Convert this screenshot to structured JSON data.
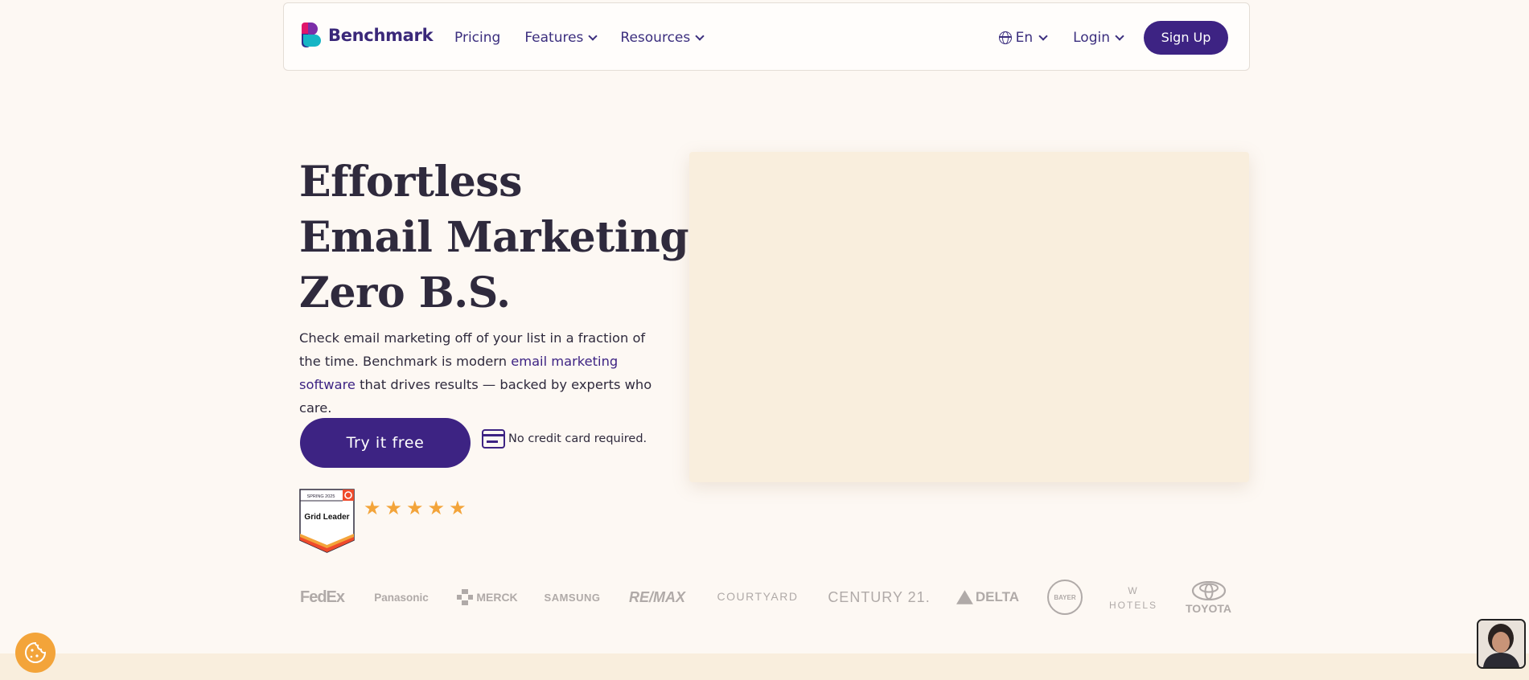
{
  "nav": {
    "brand": "Benchmark",
    "links": [
      {
        "label": "Pricing"
      },
      {
        "label": "Features"
      },
      {
        "label": "Resources"
      }
    ],
    "language": "En",
    "login": "Login",
    "signup": "Sign Up"
  },
  "hero": {
    "headline": [
      "Effortless",
      "Email Marketing.",
      "Zero B.S."
    ],
    "desc_before": "Check email marketing off of your list in a fraction of the time. Benchmark is modern ",
    "desc_link": "email marketing software",
    "desc_after": " that drives results — backed by experts who care.",
    "cta": "Try it free",
    "no_card": "No credit card required.",
    "badge": {
      "season": "SPRING 2025",
      "title": "Grid Leader"
    },
    "rating_stars": 5
  },
  "customer_logos": [
    "FedEx",
    "Panasonic",
    "MERCK",
    "SAMSUNG",
    "RE/MAX",
    "COURTYARD",
    "CENTURY 21.",
    "DELTA",
    "BAYER",
    "W HOTELS",
    "TOYOTA"
  ],
  "colors": {
    "primary": "#3d2383",
    "background": "#fdf8f3",
    "media_placeholder": "#f9eedd",
    "star": "#f3a43a",
    "logo_gray": "#b0aaa8"
  }
}
